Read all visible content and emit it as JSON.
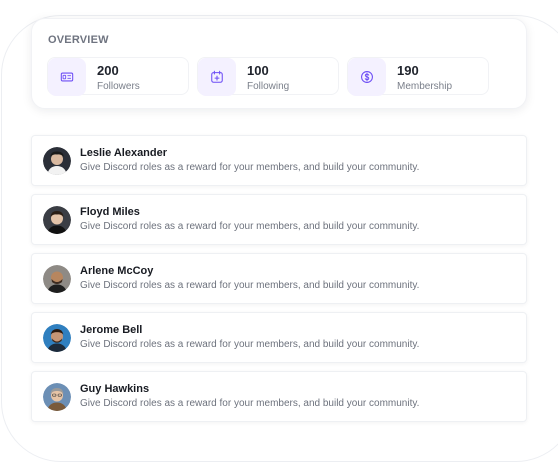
{
  "overview": {
    "title": "OVERVIEW",
    "stats": [
      {
        "value": "200",
        "label": "Followers",
        "icon": "id-card-icon"
      },
      {
        "value": "100",
        "label": "Following",
        "icon": "calendar-add-icon"
      },
      {
        "value": "190",
        "label": "Membership",
        "icon": "dollar-coin-icon"
      }
    ]
  },
  "members": [
    {
      "name": "Leslie Alexander",
      "description": "Give Discord roles as a reward for your members, and build your community."
    },
    {
      "name": "Floyd Miles",
      "description": "Give Discord roles as a reward for your members, and build your community."
    },
    {
      "name": "Arlene McCoy",
      "description": "Give Discord roles as a reward for your members, and build your community."
    },
    {
      "name": "Jerome Bell",
      "description": "Give Discord roles as a reward for your members, and build your community."
    },
    {
      "name": "Guy Hawkins",
      "description": "Give Discord roles as a reward for your members, and build your community."
    }
  ],
  "colors": {
    "accent": "#6d4ef5",
    "icon_bg": "#f4f1ff"
  }
}
